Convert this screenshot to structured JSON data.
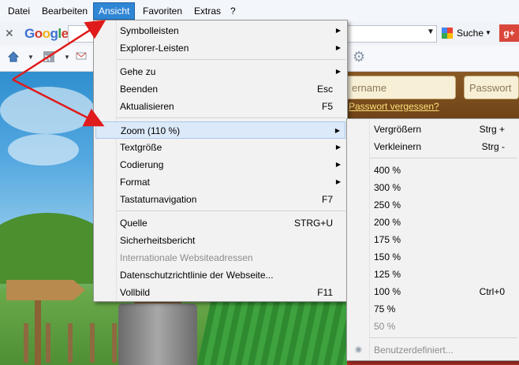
{
  "menubar": {
    "items": [
      "Datei",
      "Bearbeiten",
      "Ansicht",
      "Favoriten",
      "Extras",
      "?"
    ],
    "active_index": 2
  },
  "searchbar": {
    "google_logo": "Google",
    "search_button": "Suche",
    "gplus_label": "g+"
  },
  "page": {
    "username_placeholder": "ername",
    "password_placeholder": "Passwort",
    "forgot_link": "Passwort vergessen?"
  },
  "view_menu": {
    "items": [
      {
        "label": "Symbolleisten",
        "submenu": true
      },
      {
        "label": "Explorer-Leisten",
        "submenu": true
      },
      {
        "separator": true
      },
      {
        "label": "Gehe zu",
        "submenu": true
      },
      {
        "label": "Beenden",
        "shortcut": "Esc"
      },
      {
        "label": "Aktualisieren",
        "shortcut": "F5"
      },
      {
        "separator": true
      },
      {
        "label": "Zoom (110 %)",
        "submenu": true,
        "highlighted": true
      },
      {
        "label": "Textgröße",
        "submenu": true
      },
      {
        "label": "Codierung",
        "submenu": true
      },
      {
        "label": "Format",
        "submenu": true
      },
      {
        "label": "Tastaturnavigation",
        "shortcut": "F7"
      },
      {
        "separator": true
      },
      {
        "label": "Quelle",
        "shortcut": "STRG+U"
      },
      {
        "label": "Sicherheitsbericht"
      },
      {
        "label": "Internationale Websiteadressen",
        "disabled": true
      },
      {
        "label": "Datenschutzrichtlinie der Webseite..."
      },
      {
        "label": "Vollbild",
        "shortcut": "F11"
      }
    ]
  },
  "zoom_menu": {
    "items": [
      {
        "label": "Vergrößern",
        "shortcut": "Strg +"
      },
      {
        "label": "Verkleinern",
        "shortcut": "Strg -"
      },
      {
        "separator": true
      },
      {
        "label": "400 %"
      },
      {
        "label": "300 %"
      },
      {
        "label": "250 %"
      },
      {
        "label": "200 %"
      },
      {
        "label": "175 %"
      },
      {
        "label": "150 %"
      },
      {
        "label": "125 %"
      },
      {
        "label": "100 %",
        "shortcut": "Ctrl+0"
      },
      {
        "label": "75 %"
      },
      {
        "label": "50 %",
        "disabled": true
      },
      {
        "separator": true
      },
      {
        "label": "Benutzerdefiniert...",
        "disabled": true,
        "radio": true
      }
    ]
  },
  "colors": {
    "menu_active": "#2f86d5",
    "annotation_arrow": "#e01b1b"
  }
}
